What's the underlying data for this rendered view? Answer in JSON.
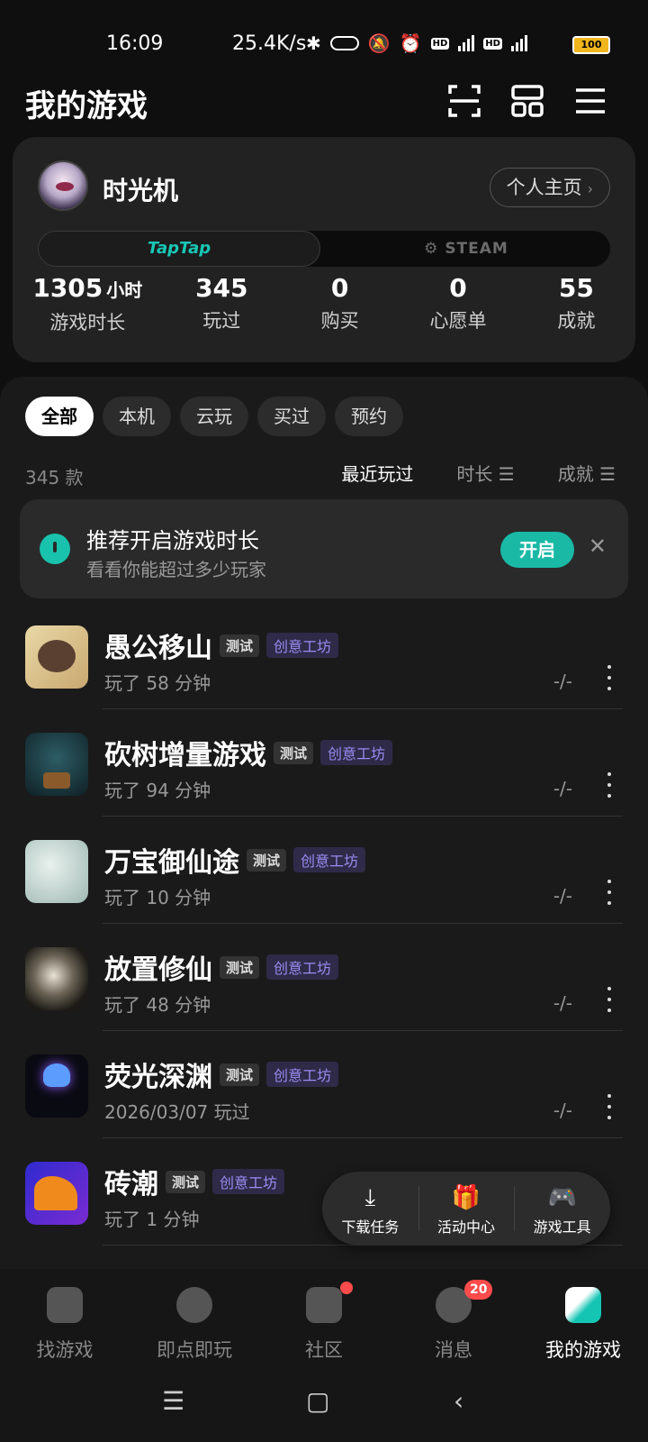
{
  "status_bar": {
    "time": "16:09",
    "speed": "25.4K/s",
    "battery": "100"
  },
  "header": {
    "title": "我的游戏",
    "icons": [
      "scan-icon",
      "layout-icon",
      "menu-icon"
    ]
  },
  "profile": {
    "username": "时光机",
    "homepage_button": "个人主页",
    "platforms": {
      "active": "TapTap",
      "inactive": "STEAM"
    },
    "stats": [
      {
        "value": "1305",
        "unit": "小时",
        "label": "游戏时长"
      },
      {
        "value": "345",
        "label": "玩过"
      },
      {
        "value": "0",
        "label": "购买"
      },
      {
        "value": "0",
        "label": "心愿单"
      },
      {
        "value": "55",
        "label": "成就"
      }
    ]
  },
  "filters": [
    "全部",
    "本机",
    "云玩",
    "买过",
    "预约"
  ],
  "count_label": "345 款",
  "sort_options": [
    "最近玩过",
    "时长",
    "成就"
  ],
  "banner": {
    "title": "推荐开启游戏时长",
    "subtitle": "看看你能超过多少玩家",
    "button": "开启"
  },
  "tags": {
    "test": "测试",
    "workshop": "创意工坊"
  },
  "games": [
    {
      "name": "愚公移山",
      "sub": "玩了 58 分钟",
      "achievement": "-/-"
    },
    {
      "name": "砍树增量游戏",
      "sub": "玩了 94 分钟",
      "achievement": "-/-"
    },
    {
      "name": "万宝御仙途",
      "sub": "玩了 10 分钟",
      "achievement": "-/-"
    },
    {
      "name": "放置修仙",
      "sub": "玩了 48 分钟",
      "achievement": "-/-"
    },
    {
      "name": "荧光深渊",
      "sub": "2026/03/07 玩过",
      "achievement": "-/-"
    },
    {
      "name": "砖潮",
      "sub": "玩了 1 分钟",
      "achievement": ""
    }
  ],
  "float_toolbar": [
    {
      "label": "下载任务",
      "icon": "download-icon"
    },
    {
      "label": "活动中心",
      "icon": "gift-icon"
    },
    {
      "label": "游戏工具",
      "icon": "gamepad-icon"
    }
  ],
  "bottom_nav": [
    {
      "label": "找游戏",
      "icon": "taptap-icon"
    },
    {
      "label": "即点即玩",
      "icon": "planet-icon"
    },
    {
      "label": "社区",
      "icon": "community-icon"
    },
    {
      "label": "消息",
      "icon": "message-icon",
      "badge": "20"
    },
    {
      "label": "我的游戏",
      "icon": "my-games-icon"
    }
  ],
  "colors": {
    "accent": "#19b9a6",
    "workshop_tag": "#9a8cf2",
    "badge": "#ff4b4b"
  }
}
